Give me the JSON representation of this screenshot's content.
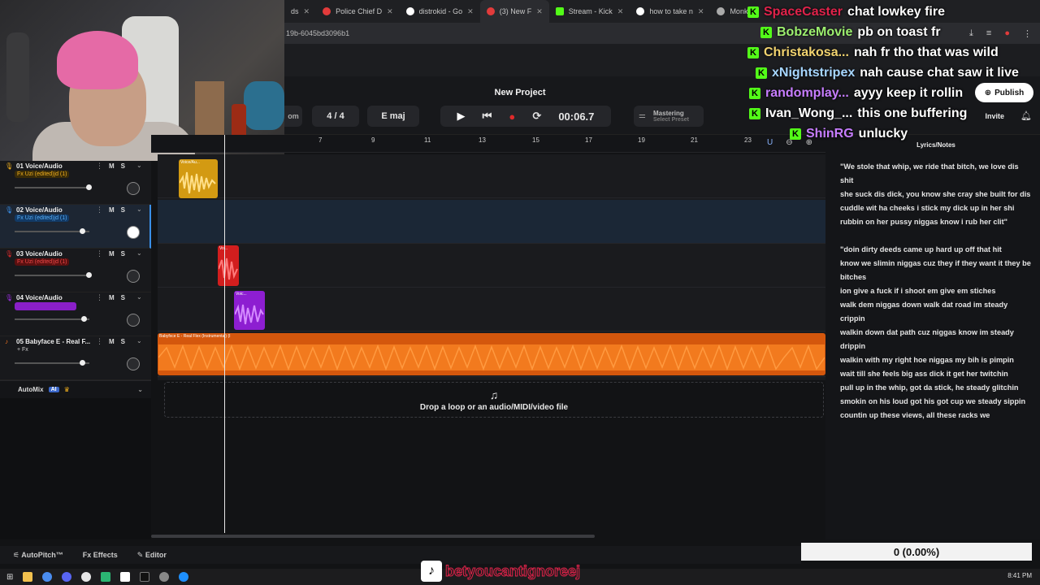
{
  "browser": {
    "tabs": [
      {
        "label": "ds",
        "color": "#888"
      },
      {
        "label": "Police Chief D",
        "color": "#e23b3b"
      },
      {
        "label": "distrokid - Go",
        "color": "#ffffff"
      },
      {
        "label": "(3) New F",
        "color": "#e23b3b"
      },
      {
        "label": "Stream - Kick",
        "color": "#53fc18"
      },
      {
        "label": "how to take n",
        "color": "#ffffff"
      },
      {
        "label": "Monke",
        "color": "#aaaaaa"
      }
    ],
    "url": "19b-6045bd3096b1"
  },
  "daw": {
    "project_title": "New Project",
    "time_signature": "4 / 4",
    "key": "E maj",
    "time": "00:06.7",
    "left_stub": "om",
    "mastering": "Mastering",
    "mastering_sub": "Select Preset",
    "publish": "Publish",
    "invite": "Invite",
    "ruler_marks": [
      "7",
      "9",
      "11",
      "13",
      "15",
      "17",
      "19",
      "21",
      "23"
    ],
    "drop_text": "Drop a loop or an audio/MIDI/video file",
    "automix": "AutoMix",
    "automix_ai": "AI",
    "tracks": [
      {
        "name": "01 Voice/Audio",
        "fx": "Fx Uzi (edited)jd (1)",
        "fx_bg": "#3a2c08",
        "fx_color": "#f2b01e",
        "color": "#f2b01e"
      },
      {
        "name": "02 Voice/Audio",
        "fx": "Fx Uzi (edited)jd (1)",
        "fx_bg": "#123a66",
        "fx_color": "#58aef5",
        "color": "#3a8fe8"
      },
      {
        "name": "03 Voice/Audio",
        "fx": "Fx Uzi (edited)jd (1)",
        "fx_bg": "#5a1010",
        "fx_color": "#f04848",
        "color": "#e02a2a"
      },
      {
        "name": "04 Voice/Audio",
        "fx": "",
        "fx_bg": "#8a1fc8",
        "fx_color": "#d27cff",
        "color": "#9b2de0"
      },
      {
        "name": "05 Babyface E - Real F...",
        "fx": "+ Fx",
        "fx_bg": "transparent",
        "fx_color": "#cccccc",
        "color": "#f2731e"
      }
    ],
    "clip_labels": {
      "c1": "Voice/Au...",
      "c3": "Vo...",
      "c4": "Voic...",
      "c5": "Babyfxce E - Real Flex (Instrumental) (I"
    },
    "bottom": {
      "autopitch": "AutoPitch™",
      "effects": "Effects",
      "editor": "Editor"
    }
  },
  "lyrics": {
    "title": "Lyrics/Notes",
    "lines": [
      "\"We stole that whip, we ride that bitch, we love dis shit",
      "she suck dis dick, you know she cray she built for dis",
      "cuddle wit ha cheeks i stick my dick up in her shi",
      "rubbin on her pussy niggas know i rub her clit\"",
      "",
      "\"doin dirty deeds came up hard up off that hit",
      "know we slimin niggas cuz they if they want it they be bitches",
      "ion give a fuck if i shoot em give em stiches",
      "walk dem niggas down walk dat road im steady crippin",
      "walkin down dat path cuz niggas know im steady drippin",
      "walkin with my right hoe niggas my bih is pimpin",
      "wait till she feels big ass dick it get her twitchin",
      "pull up in the whip, got da stick, he steady glitchin",
      "smokin on his loud got his got cup we steady sippin",
      "countin up these views, all these racks we"
    ]
  },
  "chat": [
    {
      "user": "SpaceCaster",
      "msg": "chat lowkey fire",
      "color": "#e0224a"
    },
    {
      "user": "BobzeMovie",
      "msg": "pb on toast fr",
      "color": "#9df06f"
    },
    {
      "user": "Christakosa...",
      "msg": "nah fr tho that was wild",
      "color": "#f2d36f"
    },
    {
      "user": "xNightstripex",
      "msg": "nah cause chat saw it live",
      "color": "#a6d6ff"
    },
    {
      "user": "randomplay...",
      "msg": "ayyy keep it rollin",
      "color": "#c77dff"
    },
    {
      "user": "Ivan_Wong_...",
      "msg": "this one buffering",
      "color": "#ffffff"
    },
    {
      "user": "ShinRG",
      "msg": "unlucky",
      "color": "#c77dff"
    }
  ],
  "overlay": {
    "counter": "0 (0.00%)",
    "tiktok": "betyoucantignoreej"
  },
  "taskbar": {
    "clock": "8:41 PM"
  }
}
